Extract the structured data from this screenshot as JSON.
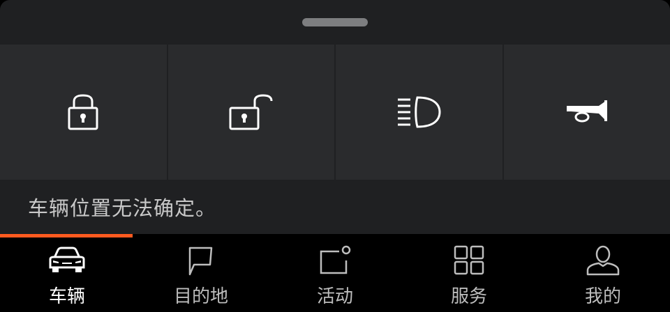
{
  "quick_actions": [
    {
      "name": "lock",
      "icon": "lock-icon"
    },
    {
      "name": "unlock",
      "icon": "unlock-icon"
    },
    {
      "name": "headlight",
      "icon": "headlight-icon"
    },
    {
      "name": "horn",
      "icon": "horn-icon"
    }
  ],
  "status_message": "车辆位置无法确定。",
  "accent_color": "#ff5a1f",
  "nav": {
    "active_index": 0,
    "items": [
      {
        "label": "车辆",
        "icon": "car-icon"
      },
      {
        "label": "目的地",
        "icon": "destination-flag-icon"
      },
      {
        "label": "活动",
        "icon": "activity-icon"
      },
      {
        "label": "服务",
        "icon": "services-grid-icon"
      },
      {
        "label": "我的",
        "icon": "profile-icon"
      }
    ]
  }
}
